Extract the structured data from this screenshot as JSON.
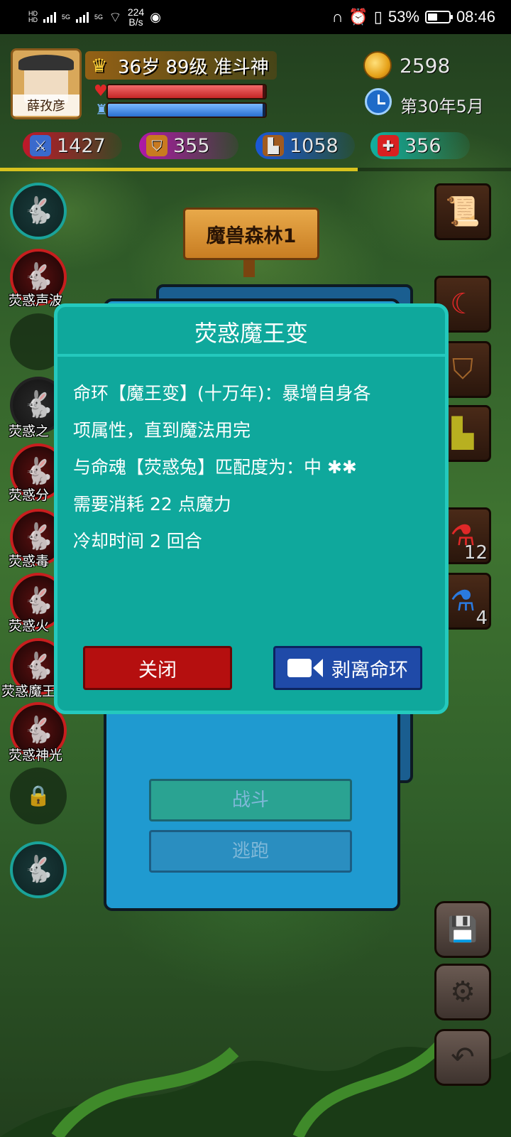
{
  "status_bar": {
    "net_speed_value": "224",
    "net_speed_unit": "B/s",
    "sig1": "5G",
    "sig2": "5G",
    "battery_percent": "53%",
    "time": "08:46"
  },
  "player": {
    "name": "薛孜彦",
    "title": "36岁 89级 准斗神",
    "gold": "2598",
    "date": "第30年5月",
    "hp_fraction": 0.98,
    "mp_fraction": 0.98,
    "exp_fraction": 0.7
  },
  "stats": {
    "attack": "1427",
    "defense": "355",
    "speed": "1058",
    "health": "356"
  },
  "location": "魔兽森林1",
  "skills": [
    {
      "label": ""
    },
    {
      "label": "荧惑声波"
    },
    {
      "label": ""
    },
    {
      "label": "荧惑之"
    },
    {
      "label": "荧惑分"
    },
    {
      "label": "荧惑毒"
    },
    {
      "label": "荧惑火"
    },
    {
      "label": "荧惑魔王"
    },
    {
      "label": "荧惑神光"
    }
  ],
  "items": {
    "red_potion_count": "12",
    "blue_potion_count": "4"
  },
  "battle": {
    "fight": "战斗",
    "flee": "逃跑"
  },
  "dialog": {
    "title": "荧惑魔王变",
    "lines": [
      "命环【魔王变】(十万年)：暴增自身各",
      "项属性，直到魔法用完",
      "与命魂【荧惑兔】匹配度为：中 ✱✱",
      "需要消耗 22 点魔力",
      "冷却时间 2 回合"
    ],
    "close": "关闭",
    "strip": "剥离命环"
  },
  "colors": {
    "dialog_bg": "#0fa89c",
    "close_btn": "#b50f0f",
    "strip_btn": "#1f4aa8",
    "exp_bar": "#d6c21e"
  },
  "icons": [
    "crown-icon",
    "heart-icon",
    "mana-potion-icon",
    "gold-coin-icon",
    "clock-icon",
    "sword-icon",
    "shield-icon",
    "boot-icon",
    "health-cross-icon",
    "map-scroll-icon",
    "weapon-icon",
    "wooden-shield-icon",
    "boots-icon",
    "red-potion-icon",
    "blue-potion-icon",
    "save-icon",
    "settings-icon",
    "back-icon",
    "lock-icon",
    "rabbit-icon",
    "video-camera-icon"
  ]
}
